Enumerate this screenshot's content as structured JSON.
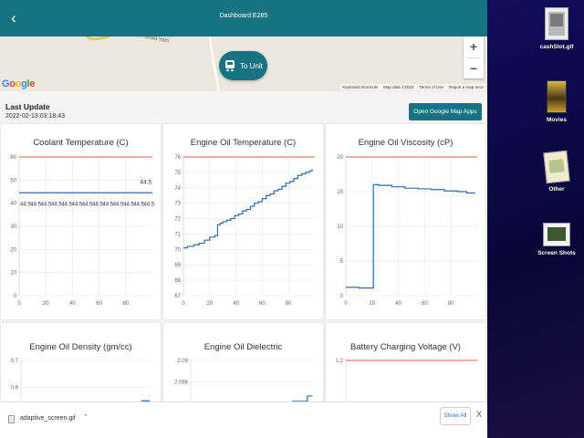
{
  "window": {
    "title": "Dashboard E285",
    "back_icon": "chevron-left-icon"
  },
  "map": {
    "to_unit_label": "To Unit",
    "zoom_in": "+",
    "zoom_out": "−",
    "google_logo": "Google",
    "street_label": "Shad Yam",
    "footer": [
      "Keyboard shortcuts",
      "Map data ©2022",
      "Terms of Use",
      "Report a map error"
    ]
  },
  "last_update": {
    "title": "Last Update",
    "timestamp": "2022-02-13 03:18:43",
    "open_maps_label": "Open Google Map Apps"
  },
  "colors": {
    "accent": "#157382",
    "series_line": "#2c6cb4",
    "limit_line": "#e05a4f",
    "grid": "#e6e6e6"
  },
  "chart_data": [
    {
      "type": "line",
      "title": "Coolant Temperature (C)",
      "xlim": [
        0,
        100
      ],
      "xticks": [
        "0",
        "20",
        "40",
        "60",
        "80"
      ],
      "ylim": [
        0,
        60
      ],
      "yticks": [
        "0",
        "10",
        "20",
        "30",
        "40",
        "50",
        "60"
      ],
      "limit": 60,
      "annotation": "44.5",
      "point_labels": [
        "44.5",
        "44.5",
        "44.5",
        "44.5",
        "44.5",
        "44.5",
        "44.5",
        "44.5",
        "44.5",
        "44.5",
        "44.5",
        "44.5",
        "44.5"
      ],
      "series": [
        {
          "x": [
            0,
            100
          ],
          "y": [
            44.5,
            44.5
          ]
        }
      ]
    },
    {
      "type": "line",
      "title": "Engine Oil Temperature (C)",
      "xlim": [
        0,
        100
      ],
      "xticks": [
        "0",
        "20",
        "40",
        "60",
        "80"
      ],
      "ylim": [
        67,
        76
      ],
      "yticks": [
        "67",
        "68",
        "69",
        "70",
        "71",
        "72",
        "73",
        "74",
        "75",
        "76"
      ],
      "limit": 76,
      "series": [
        {
          "x": [
            0,
            3,
            8,
            12,
            16,
            20,
            24,
            26,
            28,
            30,
            33,
            36,
            39,
            42,
            45,
            48,
            51,
            54,
            57,
            60,
            63,
            66,
            69,
            72,
            75,
            78,
            81,
            84,
            87,
            90,
            93,
            96,
            98
          ],
          "y": [
            70.1,
            70.2,
            70.3,
            70.4,
            70.6,
            70.8,
            70.9,
            71.6,
            71.7,
            71.8,
            71.9,
            72.0,
            72.2,
            72.3,
            72.5,
            72.6,
            72.8,
            73.0,
            73.1,
            73.3,
            73.5,
            73.6,
            73.8,
            73.9,
            74.1,
            74.3,
            74.4,
            74.6,
            74.8,
            74.9,
            75.0,
            75.1,
            75.2
          ]
        }
      ]
    },
    {
      "type": "line",
      "title": "Engine Oil Viscosity (cP)",
      "xlim": [
        0,
        100
      ],
      "xticks": [
        "0",
        "20",
        "40",
        "60",
        "80"
      ],
      "ylim": [
        0,
        20
      ],
      "yticks": [
        "0",
        "5",
        "10",
        "15",
        "20"
      ],
      "limit": 20,
      "series": [
        {
          "x": [
            0,
            10,
            20,
            21,
            25,
            35,
            45,
            55,
            65,
            75,
            85,
            92,
            98
          ],
          "y": [
            1.2,
            1.1,
            1.1,
            16.0,
            15.9,
            15.7,
            15.5,
            15.4,
            15.3,
            15.1,
            15.0,
            14.8,
            14.7
          ]
        }
      ]
    },
    {
      "type": "line",
      "title": "Engine Oil Density (gm/cc)",
      "xlim": [
        0,
        100
      ],
      "ylim": [
        0.5,
        0.7
      ],
      "yticks": [
        "0.5",
        "0.6",
        "0.7"
      ],
      "series": [
        {
          "x": [
            0,
            30,
            60,
            85,
            88,
            92,
            98
          ],
          "y": [
            0.54,
            0.542,
            0.544,
            0.545,
            0.5,
            0.55,
            0.55
          ]
        }
      ]
    },
    {
      "type": "line",
      "title": "Engine Oil Dielectric",
      "xlim": [
        0,
        100
      ],
      "ylim": [
        2.085,
        2.09
      ],
      "yticks": [
        "2.086",
        "2.088",
        "2.09"
      ],
      "series": [
        {
          "x": [
            70,
            80,
            82,
            92,
            94,
            98
          ],
          "y": [
            2.0859,
            2.0859,
            2.0862,
            2.0862,
            2.0867,
            2.0867
          ]
        }
      ]
    },
    {
      "type": "line",
      "title": "Battery Charging Voltage (V)",
      "xlim": [
        0,
        100
      ],
      "ylim": [
        0.95,
        1.2
      ],
      "yticks": [
        "1",
        "1.2"
      ],
      "limit": 1.2,
      "series": []
    }
  ],
  "download": {
    "filename": "adaptive_screen.gif",
    "show_all_label": "Show All",
    "close_label": "X"
  },
  "desktop": {
    "icons": [
      {
        "label": "cashSlot.gif",
        "icon": "gif-file-icon"
      },
      {
        "label": "Movies",
        "icon": "movies-folder-icon"
      },
      {
        "label": "Other",
        "icon": "other-folder-icon"
      },
      {
        "label": "Screen Shots",
        "icon": "screenshots-folder-icon"
      }
    ]
  }
}
